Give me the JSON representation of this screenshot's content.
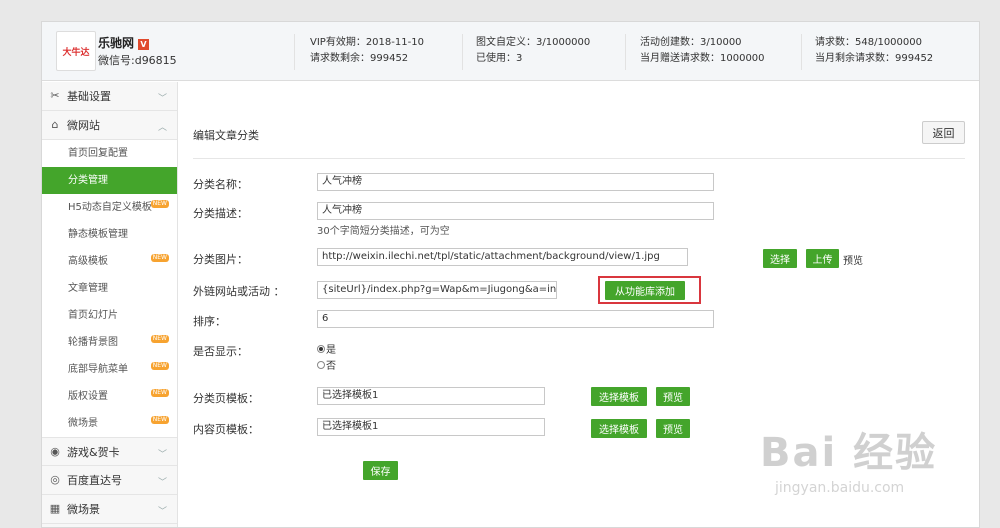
{
  "header": {
    "logo_text": "大牛达",
    "brand": "乐驰网",
    "brand_badge": "V",
    "wechat": "微信号:d96815",
    "stats": {
      "vip_expiry": "VIP有效期：2018-11-10",
      "requests_left": "请求数剩余：999452",
      "image_text": "图文自定义：3/1000000",
      "used": "已使用：3",
      "activities": "活动创建数：3/10000",
      "monthly_gift": "当月赠送请求数：1000000",
      "requests": "请求数：548/1000000",
      "monthly_left": "当月剩余请求数：999452"
    }
  },
  "sidebar": {
    "groups": [
      {
        "label": "基础设置",
        "icon": "tools-icon"
      },
      {
        "label": "微网站",
        "icon": "home-icon"
      }
    ],
    "subitems": [
      {
        "label": "首页回复配置",
        "new": false
      },
      {
        "label": "分类管理",
        "new": false,
        "active": true
      },
      {
        "label": "H5动态自定义模板",
        "new": true
      },
      {
        "label": "静态模板管理",
        "new": false
      },
      {
        "label": "高级模板",
        "new": true
      },
      {
        "label": "文章管理",
        "new": false
      },
      {
        "label": "首页幻灯片",
        "new": false
      },
      {
        "label": "轮播背景图",
        "new": true
      },
      {
        "label": "底部导航菜单",
        "new": true
      },
      {
        "label": "版权设置",
        "new": true
      },
      {
        "label": "微场景",
        "new": true
      }
    ],
    "bottom_groups": [
      {
        "label": "游戏&贺卡",
        "icon": "gamepad-icon"
      },
      {
        "label": "百度直达号",
        "icon": "target-icon"
      },
      {
        "label": "微场景",
        "icon": "grid-icon"
      }
    ],
    "new_badge": "NEW"
  },
  "main": {
    "title": "编辑文章分类",
    "back_label": "返回",
    "fields": {
      "name_label": "分类名称：",
      "name_value": "人气冲榜",
      "desc_label": "分类描述：",
      "desc_value": "人气冲榜",
      "desc_hint": "30个字简短分类描述，可为空",
      "image_label": "分类图片：",
      "image_value": "http://weixin.ilechi.net/tpl/static/attachment/background/view/1.jpg",
      "choose_label": "选择",
      "upload_label": "上传",
      "preview_text": "预览",
      "link_label": "外链网站或活动 ：",
      "link_value": "{siteUrl}/index.php?g=Wap&m=Jiugong&a=in",
      "add_from_lib_label": "从功能库添加",
      "sort_label": "排序：",
      "sort_value": "6",
      "show_label": "是否显示：",
      "show_yes": "是",
      "show_no": "否",
      "cat_tpl_label": "分类页模板：",
      "cat_tpl_value": "已选择模板1",
      "content_tpl_label": "内容页模板：",
      "content_tpl_value": "已选择模板1",
      "choose_tpl_label": "选择模板",
      "preview_label": "预览",
      "save_label": "保存"
    }
  },
  "watermark": {
    "main": "Bai 经验",
    "sub": "jingyan.baidu.com"
  }
}
